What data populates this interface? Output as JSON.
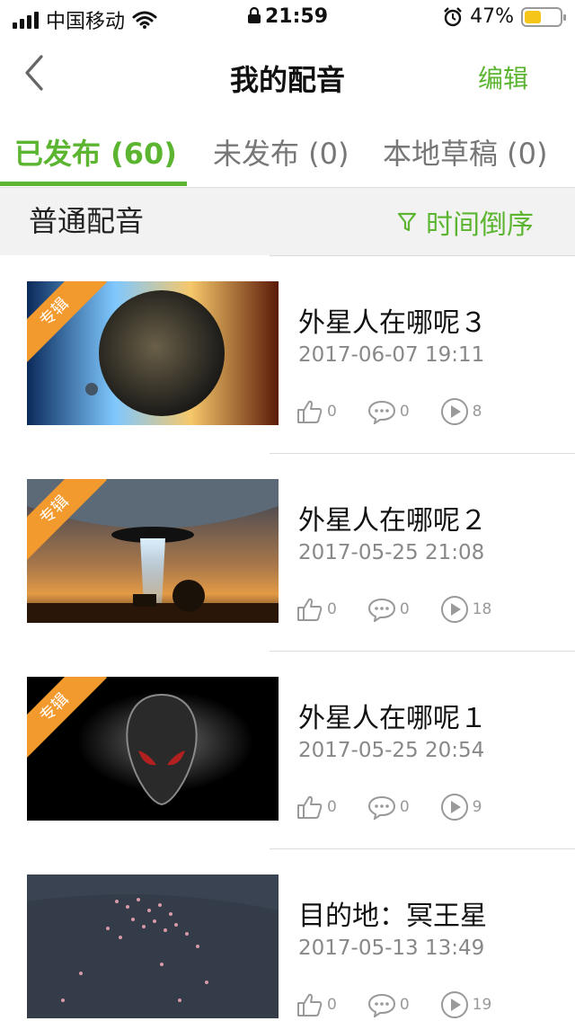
{
  "status_bar": {
    "carrier": "中国移动",
    "time": "21:59",
    "battery_percent": "47%",
    "battery_level": 0.47,
    "battery_color": "#f5c518"
  },
  "nav": {
    "title": "我的配音",
    "edit_label": "编辑",
    "back_icon": "chevron-left-icon"
  },
  "tabs": [
    {
      "label": "已发布 (60)",
      "active": true
    },
    {
      "label": "未发布 (0)",
      "active": false
    },
    {
      "label": "本地草稿 (0)",
      "active": false
    }
  ],
  "filter": {
    "section_title": "普通配音",
    "sort_label": "时间倒序",
    "sort_icon": "filter-icon"
  },
  "items": [
    {
      "title": "外星人在哪呢３",
      "date": "2017-06-07 19:11",
      "badge": "专辑",
      "likes": "0",
      "comments": "0",
      "plays": "8"
    },
    {
      "title": "外星人在哪呢２",
      "date": "2017-05-25 21:08",
      "badge": "专辑",
      "likes": "0",
      "comments": "0",
      "plays": "18"
    },
    {
      "title": "外星人在哪呢１",
      "date": "2017-05-25 20:54",
      "badge": "专辑",
      "likes": "0",
      "comments": "0",
      "plays": "9"
    },
    {
      "title": "目的地：冥王星",
      "date": "2017-05-13 13:49",
      "badge": "",
      "likes": "0",
      "comments": "0",
      "plays": "19"
    }
  ],
  "colors": {
    "accent": "#5cb531",
    "badge": "#f39a2e",
    "filter_bar_bg": "#f2f2f2"
  }
}
